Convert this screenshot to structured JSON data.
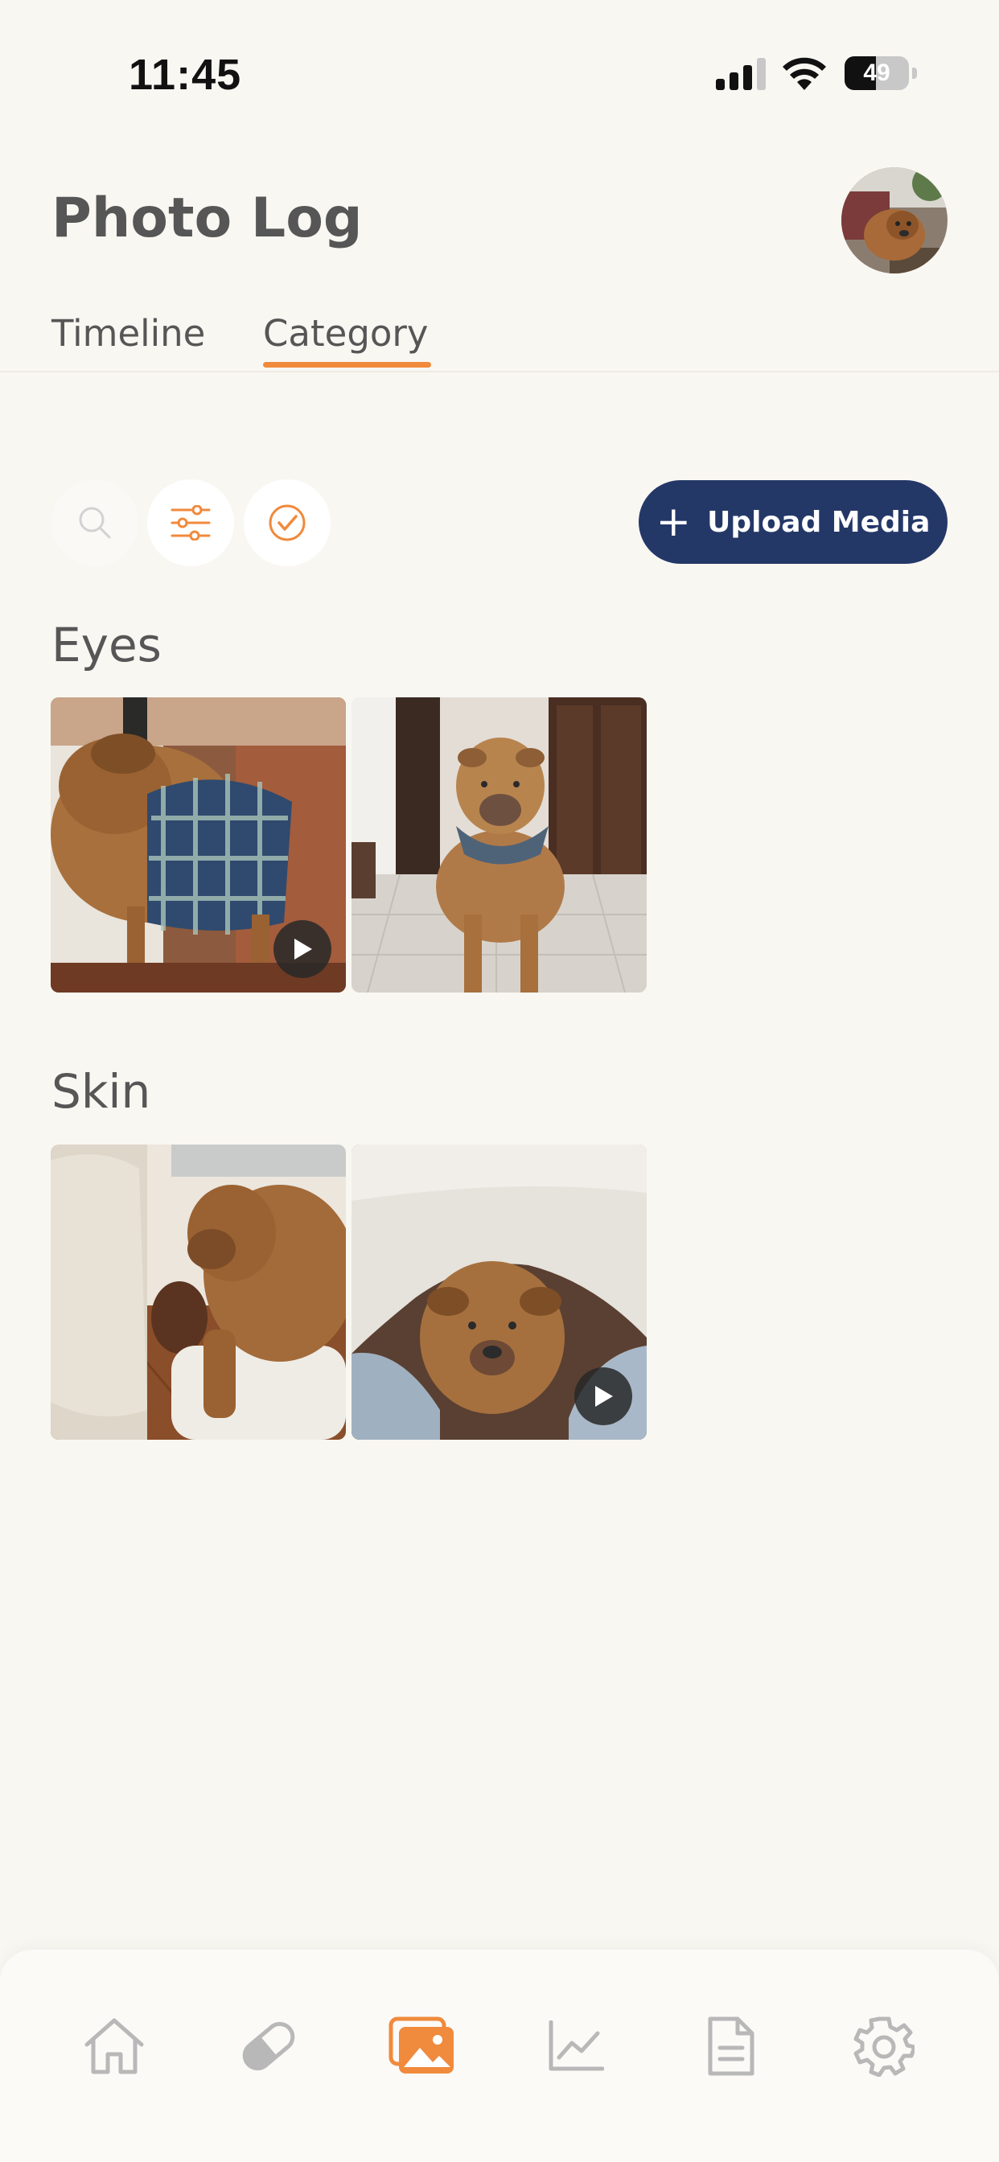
{
  "status_bar": {
    "time": "11:45",
    "battery": "49",
    "battery_level": 0.49
  },
  "header": {
    "title": "Photo Log",
    "avatar_icon": "dog-avatar"
  },
  "tabs": [
    {
      "label": "Timeline",
      "active": false
    },
    {
      "label": "Category",
      "active": true
    }
  ],
  "toolbar": {
    "search_icon": "search-icon",
    "filter_icon": "sliders-icon",
    "select_icon": "check-circle-icon",
    "upload_label": "Upload Media",
    "upload_icon": "plus-icon"
  },
  "sections": [
    {
      "title": "Eyes",
      "items": [
        {
          "media": "dog-in-plaid-coat",
          "is_video": true
        },
        {
          "media": "dog-standing-in-hallway",
          "is_video": false
        }
      ]
    },
    {
      "title": "Skin",
      "items": [
        {
          "media": "dog-on-sofa",
          "is_video": false
        },
        {
          "media": "dog-under-blanket",
          "is_video": true
        }
      ]
    }
  ],
  "bottom_nav": [
    {
      "icon": "home-icon",
      "active": false
    },
    {
      "icon": "pill-icon",
      "active": false
    },
    {
      "icon": "photos-icon",
      "active": true
    },
    {
      "icon": "chart-icon",
      "active": false
    },
    {
      "icon": "document-icon",
      "active": false
    },
    {
      "icon": "gear-icon",
      "active": false
    }
  ],
  "colors": {
    "background": "#f9f7f2",
    "accent": "#f08a3c",
    "primary_button": "#243868",
    "text": "#565656",
    "nav_inactive": "#b8b8b8"
  }
}
